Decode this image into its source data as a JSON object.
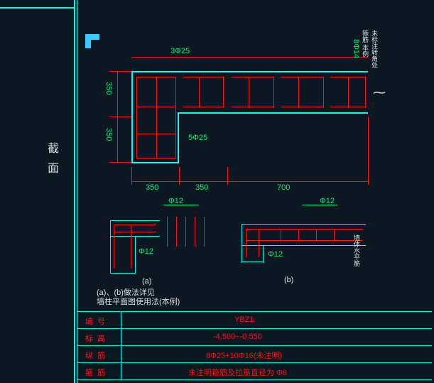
{
  "meta": {
    "software_hint": "AutoCAD structural detail",
    "element": "YBZ1 boundary element reinforcement detail"
  },
  "side_label": "截面",
  "dims": {
    "left_v1": "350",
    "left_v2": "350",
    "bot_1": "350",
    "bot_2": "350",
    "bot_3": "700",
    "top_bar": "3Φ25",
    "inner_bar": "5Φ25",
    "right_tie": "8Φ14",
    "right_note": "未标注转角处\n箍筋 本例",
    "d12_a": "Φ12",
    "d12_b": "Φ12",
    "d12_c": "Φ12",
    "d12_d": "Φ12",
    "tag_a": "(a)",
    "tag_b": "(b)",
    "note_ab": "(a)、(b)做法详见\n墙柱平面图使用法(本例)",
    "vnote": "墙体水平筋"
  },
  "table": {
    "h1": "编号",
    "v1": "YBZ1",
    "h2": "标高",
    "v2": "-4.500~-0.550",
    "h3": "纵筋",
    "v3": "8Φ25+10Φ16(未注明)",
    "h4": "箍筋",
    "v4": "未注明箍筋及拉筋直径为 Φ8"
  },
  "chart_data": {
    "type": "diagram",
    "element_id": "YBZ1",
    "elevation_range": [
      -4.5,
      -0.55
    ],
    "shape": "L-shaped boundary element + flange",
    "dimensions_mm": {
      "h_cells": [
        350,
        350,
        700
      ],
      "v_cells": [
        350,
        350
      ]
    },
    "longitudinal_bars": {
      "top": "3Φ25",
      "bottom_inner": "5Φ25",
      "total": "8Φ25 + 10Φ16"
    },
    "ties": {
      "corner": "8Φ14",
      "other": "Φ12",
      "default_diameter": "Φ8"
    },
    "sub_details": [
      "(a)",
      "(b)"
    ]
  }
}
